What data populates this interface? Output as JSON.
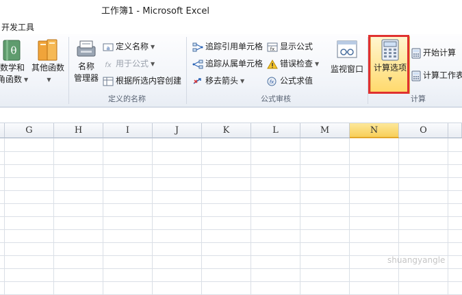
{
  "window": {
    "title": "工作簿1 - Microsoft Excel"
  },
  "ribbon_tab": "开发工具",
  "groups": {
    "library": {
      "math_line1": "数学和",
      "math_line2": "角函数",
      "other_funcs": "其他函数"
    },
    "defined_names": {
      "name_manager_line1": "名称",
      "name_manager_line2": "管理器",
      "define_name": "定义名称",
      "use_in_formula": "用于公式",
      "create_from_selection": "根据所选内容创建",
      "label": "定义的名称"
    },
    "formula_auditing": {
      "trace_precedents": "追踪引用单元格",
      "trace_dependents": "追踪从属单元格",
      "remove_arrows": "移去箭头",
      "show_formulas": "显示公式",
      "error_checking": "错误检查",
      "evaluate_formula": "公式求值",
      "watch_window": "监视窗口",
      "label": "公式审核"
    },
    "calculation": {
      "calc_options": "计算选项",
      "calc_now": "开始计算",
      "calc_sheet": "计算工作表",
      "label": "计算"
    }
  },
  "columns": [
    "G",
    "H",
    "I",
    "J",
    "K",
    "L",
    "M",
    "N",
    "O"
  ],
  "selected_column": "N",
  "colors": {
    "highlight_border": "#e0312f",
    "selected_header": "#f8cf59",
    "calc_button": "#ffd96b"
  },
  "watermark": "shuangyangle"
}
